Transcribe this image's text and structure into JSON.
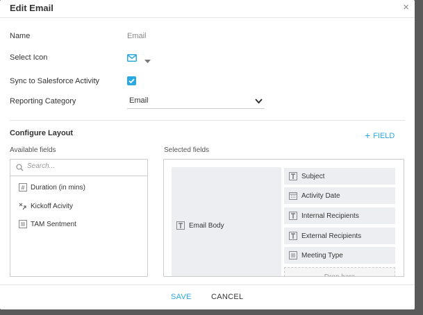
{
  "modal": {
    "title": "Edit Email",
    "close": "×"
  },
  "form": {
    "name_label": "Name",
    "name_value": "Email",
    "icon_label": "Select Icon",
    "icon_name": "mail-icon",
    "sync_label": "Sync to Salesforce Activity",
    "sync_checked": true,
    "category_label": "Reporting Category",
    "category_value": "Email"
  },
  "layout": {
    "heading": "Configure Layout",
    "add_field": "FIELD",
    "available_label": "Available fields",
    "selected_label": "Selected fields",
    "search_placeholder": "Search...",
    "available_fields": [
      {
        "label": "Duration (in mins)",
        "icon": "number-field-icon"
      },
      {
        "label": "Kickoff Acivity",
        "icon": "lookup-field-icon"
      },
      {
        "label": "TAM Sentment",
        "icon": "picklist-field-icon"
      }
    ],
    "body_field": {
      "label": "Email Body",
      "icon": "text-field-icon"
    },
    "selected_fields": [
      {
        "label": "Subject",
        "icon": "text-field-icon"
      },
      {
        "label": "Activity Date",
        "icon": "calendar-field-icon"
      },
      {
        "label": "Internal Recipients",
        "icon": "text-field-icon"
      },
      {
        "label": "External Recipients",
        "icon": "text-field-icon"
      },
      {
        "label": "Meeting Type",
        "icon": "picklist-field-icon"
      }
    ],
    "drop_text": "Drop here"
  },
  "footer": {
    "save": "SAVE",
    "cancel": "CANCEL"
  },
  "colors": {
    "accent": "#29a9e0",
    "field_bg": "#eceef1"
  }
}
